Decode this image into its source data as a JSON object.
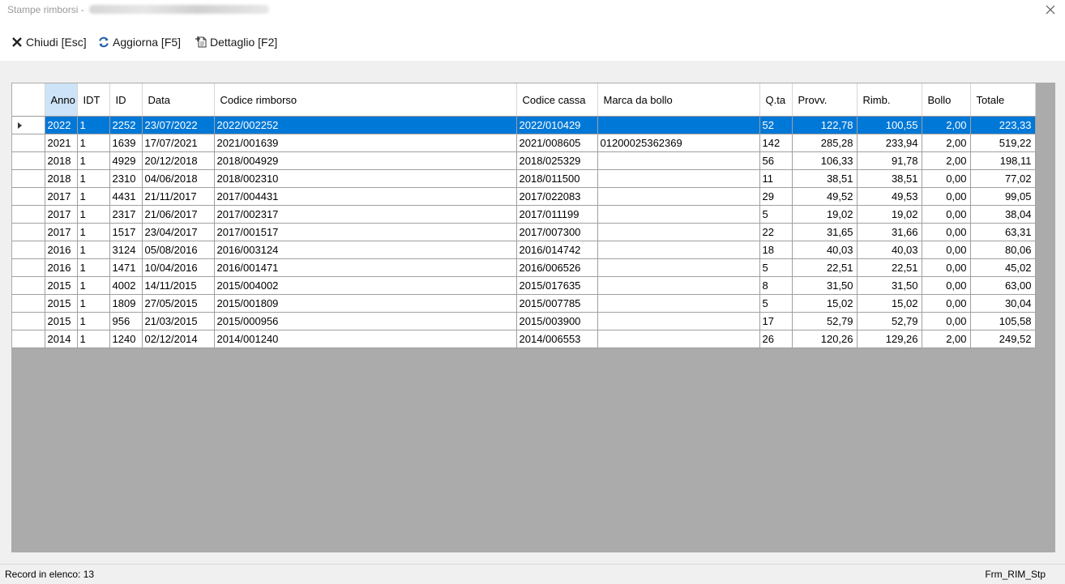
{
  "window": {
    "title": "Stampe rimborsi -"
  },
  "toolbar": {
    "close_label": "Chiudi [Esc]",
    "refresh_label": "Aggiorna [F5]",
    "detail_label": "Dettaglio [F2]"
  },
  "grid": {
    "columns": [
      "Anno",
      "IDT",
      "ID",
      "Data",
      "Codice rimborso",
      "Codice cassa",
      "Marca da bollo",
      "Q.ta",
      "Provv.",
      "Rimb.",
      "Bollo",
      "Totale"
    ],
    "sorted_column": "Anno",
    "selected_row": 0,
    "rows": [
      [
        "2022",
        "1",
        "2252",
        "23/07/2022",
        "2022/002252",
        "2022/010429",
        "",
        "52",
        "122,78",
        "100,55",
        "2,00",
        "223,33"
      ],
      [
        "2021",
        "1",
        "1639",
        "17/07/2021",
        "2021/001639",
        "2021/008605",
        "01200025362369",
        "142",
        "285,28",
        "233,94",
        "2,00",
        "519,22"
      ],
      [
        "2018",
        "1",
        "4929",
        "20/12/2018",
        "2018/004929",
        "2018/025329",
        "",
        "56",
        "106,33",
        "91,78",
        "2,00",
        "198,11"
      ],
      [
        "2018",
        "1",
        "2310",
        "04/06/2018",
        "2018/002310",
        "2018/011500",
        "",
        "11",
        "38,51",
        "38,51",
        "0,00",
        "77,02"
      ],
      [
        "2017",
        "1",
        "4431",
        "21/11/2017",
        "2017/004431",
        "2017/022083",
        "",
        "29",
        "49,52",
        "49,53",
        "0,00",
        "99,05"
      ],
      [
        "2017",
        "1",
        "2317",
        "21/06/2017",
        "2017/002317",
        "2017/011199",
        "",
        "5",
        "19,02",
        "19,02",
        "0,00",
        "38,04"
      ],
      [
        "2017",
        "1",
        "1517",
        "23/04/2017",
        "2017/001517",
        "2017/007300",
        "",
        "22",
        "31,65",
        "31,66",
        "0,00",
        "63,31"
      ],
      [
        "2016",
        "1",
        "3124",
        "05/08/2016",
        "2016/003124",
        "2016/014742",
        "",
        "18",
        "40,03",
        "40,03",
        "0,00",
        "80,06"
      ],
      [
        "2016",
        "1",
        "1471",
        "10/04/2016",
        "2016/001471",
        "2016/006526",
        "",
        "5",
        "22,51",
        "22,51",
        "0,00",
        "45,02"
      ],
      [
        "2015",
        "1",
        "4002",
        "14/11/2015",
        "2015/004002",
        "2015/017635",
        "",
        "8",
        "31,50",
        "31,50",
        "0,00",
        "63,00"
      ],
      [
        "2015",
        "1",
        "1809",
        "27/05/2015",
        "2015/001809",
        "2015/007785",
        "",
        "5",
        "15,02",
        "15,02",
        "0,00",
        "30,04"
      ],
      [
        "2015",
        "1",
        "956",
        "21/03/2015",
        "2015/000956",
        "2015/003900",
        "",
        "17",
        "52,79",
        "52,79",
        "0,00",
        "105,58"
      ],
      [
        "2014",
        "1",
        "1240",
        "02/12/2014",
        "2014/001240",
        "2014/006553",
        "",
        "26",
        "120,26",
        "129,26",
        "2,00",
        "249,52"
      ]
    ]
  },
  "status": {
    "records_label": "Record in elenco: 13",
    "form_name": "Frm_RIM_Stp"
  },
  "colors": {
    "selection": "#0078d7",
    "sorted_header": "#cde3f7",
    "grid_background": "#ababab"
  },
  "icons": {
    "close": "x-icon",
    "refresh": "refresh-icon",
    "detail": "document-detail-icon",
    "window_close": "close-icon"
  }
}
